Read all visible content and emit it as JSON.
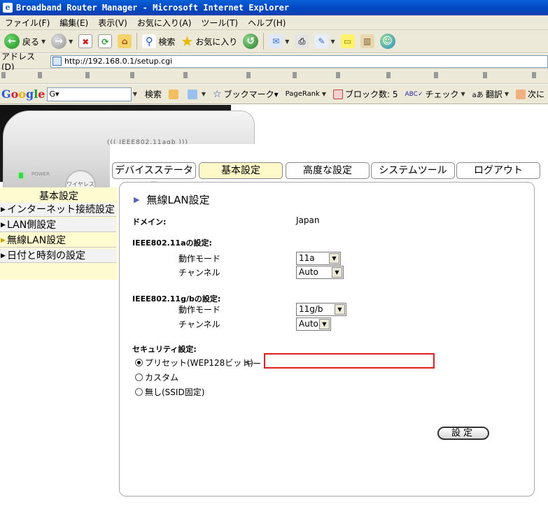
{
  "window": {
    "title": "Broadband Router Manager - Microsoft Internet Explorer"
  },
  "menu": [
    "ファイル(F)",
    "編集(E)",
    "表示(V)",
    "お気に入り(A)",
    "ツール(T)",
    "ヘルプ(H)"
  ],
  "toolbar": {
    "back": "戻る",
    "search": "検索",
    "favorites": "お気に入り"
  },
  "address": {
    "label": "アドレス(D)",
    "url": "http://192.168.0.1/setup.cgi"
  },
  "google_toolbar": {
    "logo": "Google",
    "search_box": "G▾",
    "search": "検索",
    "bookmarks": "ブックマーク▾",
    "pagerank": "PageRank",
    "blocked": "ブロック数: 5",
    "check": "チェック",
    "translate": "翻訳",
    "next": "次に"
  },
  "router": {
    "model": "((( IEEE802.11agb )))",
    "power": "POWER",
    "wireless_btn": "ワイヤレス"
  },
  "tabs": [
    "デバイスステータス",
    "基本設定",
    "高度な設定",
    "システムツール",
    "ログアウト"
  ],
  "sidebar": {
    "title": "基本設定",
    "items": [
      "インターネット接続設定",
      "LAN側設定",
      "無線LAN設定",
      "日付と時刻の設定"
    ]
  },
  "panel": {
    "heading": "無線LAN設定",
    "domain_label": "ドメイン:",
    "domain_value": "Japan",
    "a_section": "IEEE802.11aの設定:",
    "a_mode_label": "動作モード",
    "a_mode_value": "11a",
    "a_channel_label": "チャンネル",
    "a_channel_value": "Auto",
    "gb_section": "IEEE802.11g/bの設定:",
    "gb_mode_label": "動作モード",
    "gb_mode_value": "11g/b",
    "gb_channel_label": "チャンネル",
    "gb_channel_value": "Auto",
    "security_section": "セキュリティ設定:",
    "opt_preset": "プリセット(WEP128ビット)",
    "key_label": "キー",
    "key_value": "",
    "opt_custom": "カスタム",
    "opt_none": "無し(SSID固定)",
    "submit": "設定"
  }
}
